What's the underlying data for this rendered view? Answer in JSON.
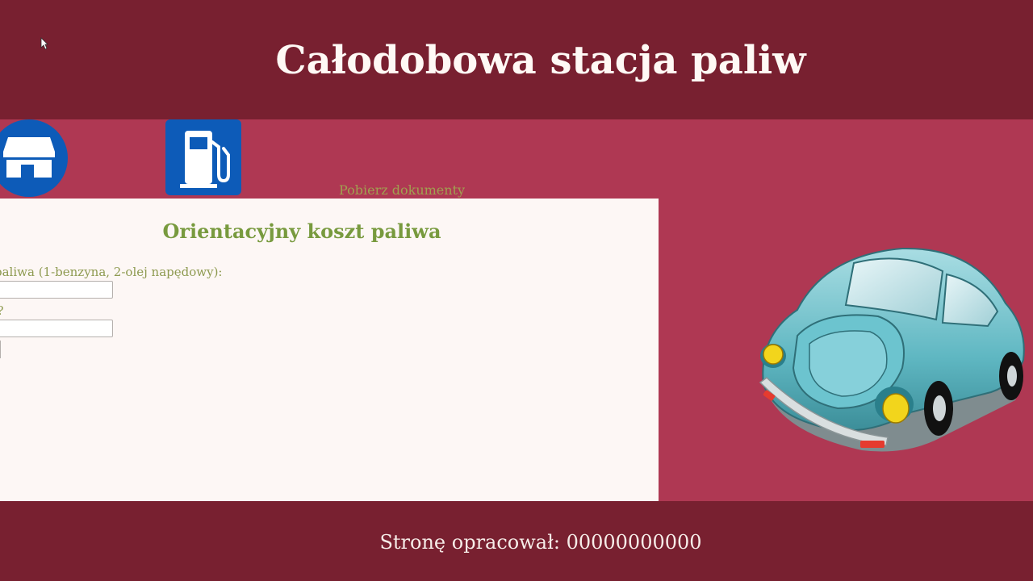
{
  "header": {
    "title": "Całodobowa stacja paliw"
  },
  "nav": {
    "shop_icon": "shop-icon",
    "fuel_icon": "fuel-pump-icon",
    "docs_link": "Pobierz dokumenty",
    "icon_color": "#0d5bb8"
  },
  "form": {
    "heading": "Orientacyjny koszt paliwa",
    "fuel_type_label": "paliwa (1-benzyna, 2-olej napędowy):",
    "fuel_type_value": "",
    "liters_label": "y?",
    "liters_value": ""
  },
  "illustration": {
    "car_icon": "car-icon"
  },
  "footer": {
    "text": "Stronę opracował: 00000000000"
  },
  "colors": {
    "header_footer": "#782030",
    "body": "#af3853",
    "panel": "#fdf7f5",
    "heading_green": "#789a3e"
  }
}
